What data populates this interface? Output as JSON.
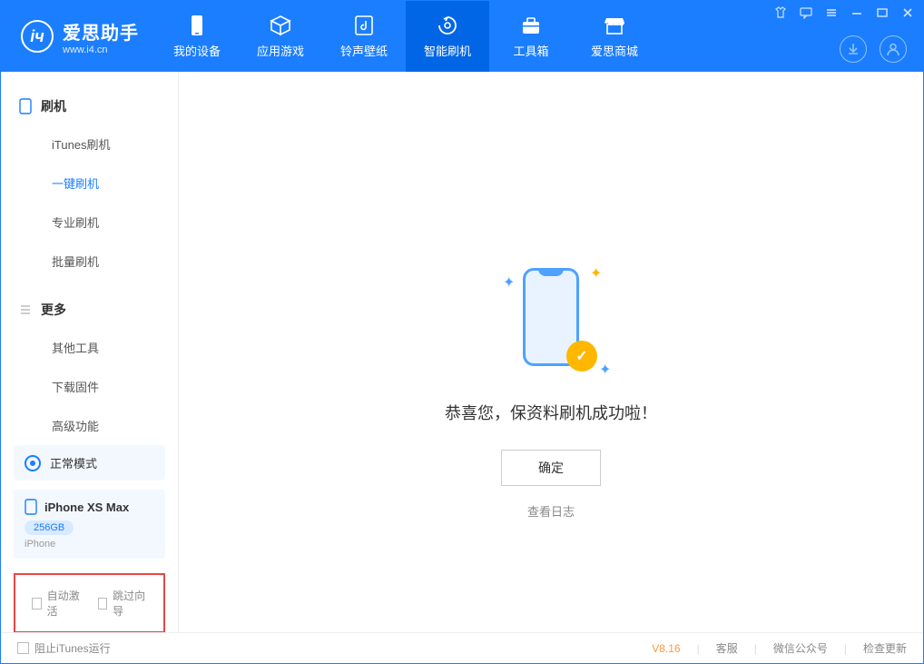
{
  "app": {
    "name": "爱思助手",
    "url": "www.i4.cn"
  },
  "nav": {
    "tabs": [
      {
        "label": "我的设备"
      },
      {
        "label": "应用游戏"
      },
      {
        "label": "铃声壁纸"
      },
      {
        "label": "智能刷机"
      },
      {
        "label": "工具箱"
      },
      {
        "label": "爱思商城"
      }
    ]
  },
  "sidebar": {
    "section1": {
      "title": "刷机",
      "items": [
        "iTunes刷机",
        "一键刷机",
        "专业刷机",
        "批量刷机"
      ]
    },
    "section2": {
      "title": "更多",
      "items": [
        "其他工具",
        "下载固件",
        "高级功能"
      ]
    },
    "mode": {
      "label": "正常模式"
    },
    "device": {
      "name": "iPhone XS Max",
      "storage": "256GB",
      "type": "iPhone"
    },
    "checkboxes": {
      "auto_activate": "自动激活",
      "skip_guide": "跳过向导"
    }
  },
  "main": {
    "success_text": "恭喜您，保资料刷机成功啦！",
    "confirm_label": "确定",
    "view_log_label": "查看日志"
  },
  "footer": {
    "prevent_itunes": "阻止iTunes运行",
    "version": "V8.16",
    "links": {
      "support": "客服",
      "wechat": "微信公众号",
      "update": "检查更新"
    }
  }
}
